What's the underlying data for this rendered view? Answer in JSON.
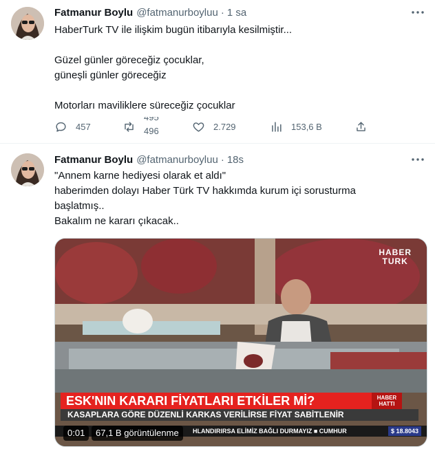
{
  "tweets": [
    {
      "author": {
        "name": "Fatmanur Boylu",
        "handle": "@fatmanurboyluu"
      },
      "separator": "·",
      "time": "1 sa",
      "lines": [
        "HaberTurk TV ile ilişkim bugün itibarıyla kesilmiştir...",
        "",
        "Güzel günler göreceğiz çocuklar,",
        "güneşli günler göreceğiz",
        "",
        "Motorları maviliklere süreceğiz çocuklar"
      ],
      "stats": {
        "replies": "457",
        "retweets_old": "495",
        "retweets_new": "496",
        "likes": "2.729",
        "views": "153,6 B"
      }
    },
    {
      "author": {
        "name": "Fatmanur Boylu",
        "handle": "@fatmanurboyluu"
      },
      "separator": "·",
      "time": "18s",
      "lines": [
        "\"Annem karne hediyesi olarak et aldı\"",
        "haberimden dolayı Haber Türk TV hakkımda kurum içi sorusturma",
        "başlatmış..",
        "Bakalım ne kararı çıkacak.."
      ],
      "video": {
        "logo_line1": "HABER",
        "logo_line2": "TURK",
        "headline": "ESK'NIN KARARI FİYATLARI ETKİLER Mİ?",
        "tag_line1": "HABER",
        "tag_line2": "HATTI",
        "subline": "KASAPLARA GÖRE DÜZENLİ KARKAS VERİLİRSE FİYAT SABİTLENİR",
        "bottom_ticker": "HLANDIRIRSA ELİMİZ BAĞLI DURMAYIZ   ■  CUMHUR",
        "usd": "$ 18.8043",
        "elapsed": "0:01",
        "views": "67,1 B görüntülenme"
      }
    }
  ],
  "colors": {
    "text": "#0f1419",
    "secondary": "#536471",
    "divider": "#eff3f4",
    "ticker_red": "#e5221f"
  },
  "icons": [
    "more-icon",
    "reply-icon",
    "retweet-icon",
    "like-icon",
    "views-icon",
    "share-icon"
  ]
}
